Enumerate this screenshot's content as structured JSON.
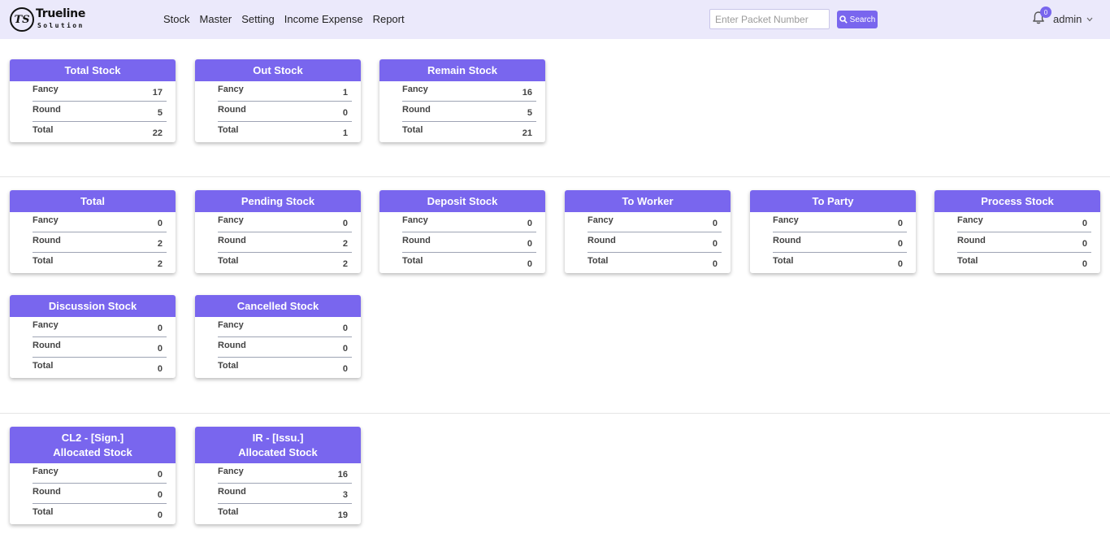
{
  "brand": {
    "name": "Trueline",
    "sub": "Solution",
    "mark": "TS"
  },
  "nav": {
    "items": [
      "Stock",
      "Master",
      "Setting",
      "Income Expense",
      "Report"
    ]
  },
  "search": {
    "placeholder": "Enter Packet Number",
    "value": "",
    "button_label": "Search"
  },
  "user": {
    "notifications": "0",
    "name": "admin"
  },
  "colors": {
    "accent": "#7966ee",
    "navbar_bg": "#ebe9fb"
  },
  "cards": [
    {
      "title": "Total Stock",
      "rows": [
        {
          "label": "Fancy",
          "value": "17"
        },
        {
          "label": "Round",
          "value": "5"
        },
        {
          "label": "Total",
          "value": "22"
        }
      ]
    },
    {
      "title": "Out Stock",
      "rows": [
        {
          "label": "Fancy",
          "value": "1"
        },
        {
          "label": "Round",
          "value": "0"
        },
        {
          "label": "Total",
          "value": "1"
        }
      ]
    },
    {
      "title": "Remain Stock",
      "rows": [
        {
          "label": "Fancy",
          "value": "16"
        },
        {
          "label": "Round",
          "value": "5"
        },
        {
          "label": "Total",
          "value": "21"
        }
      ]
    },
    {
      "title": "Total",
      "rows": [
        {
          "label": "Fancy",
          "value": "0"
        },
        {
          "label": "Round",
          "value": "2"
        },
        {
          "label": "Total",
          "value": "2"
        }
      ]
    },
    {
      "title": "Pending Stock",
      "rows": [
        {
          "label": "Fancy",
          "value": "0"
        },
        {
          "label": "Round",
          "value": "2"
        },
        {
          "label": "Total",
          "value": "2"
        }
      ]
    },
    {
      "title": "Deposit Stock",
      "rows": [
        {
          "label": "Fancy",
          "value": "0"
        },
        {
          "label": "Round",
          "value": "0"
        },
        {
          "label": "Total",
          "value": "0"
        }
      ]
    },
    {
      "title": "To Worker",
      "rows": [
        {
          "label": "Fancy",
          "value": "0"
        },
        {
          "label": "Round",
          "value": "0"
        },
        {
          "label": "Total",
          "value": "0"
        }
      ]
    },
    {
      "title": "To Party",
      "rows": [
        {
          "label": "Fancy",
          "value": "0"
        },
        {
          "label": "Round",
          "value": "0"
        },
        {
          "label": "Total",
          "value": "0"
        }
      ]
    },
    {
      "title": "Process Stock",
      "rows": [
        {
          "label": "Fancy",
          "value": "0"
        },
        {
          "label": "Round",
          "value": "0"
        },
        {
          "label": "Total",
          "value": "0"
        }
      ]
    },
    {
      "title": "Discussion Stock",
      "rows": [
        {
          "label": "Fancy",
          "value": "0"
        },
        {
          "label": "Round",
          "value": "0"
        },
        {
          "label": "Total",
          "value": "0"
        }
      ]
    },
    {
      "title": "Cancelled Stock",
      "rows": [
        {
          "label": "Fancy",
          "value": "0"
        },
        {
          "label": "Round",
          "value": "0"
        },
        {
          "label": "Total",
          "value": "0"
        }
      ]
    },
    {
      "title": "CL2 - [Sign.]",
      "title2": "Allocated Stock",
      "rows": [
        {
          "label": "Fancy",
          "value": "0"
        },
        {
          "label": "Round",
          "value": "0"
        },
        {
          "label": "Total",
          "value": "0"
        }
      ]
    },
    {
      "title": "IR - [Issu.]",
      "title2": "Allocated Stock",
      "rows": [
        {
          "label": "Fancy",
          "value": "16"
        },
        {
          "label": "Round",
          "value": "3"
        },
        {
          "label": "Total",
          "value": "19"
        }
      ]
    }
  ]
}
